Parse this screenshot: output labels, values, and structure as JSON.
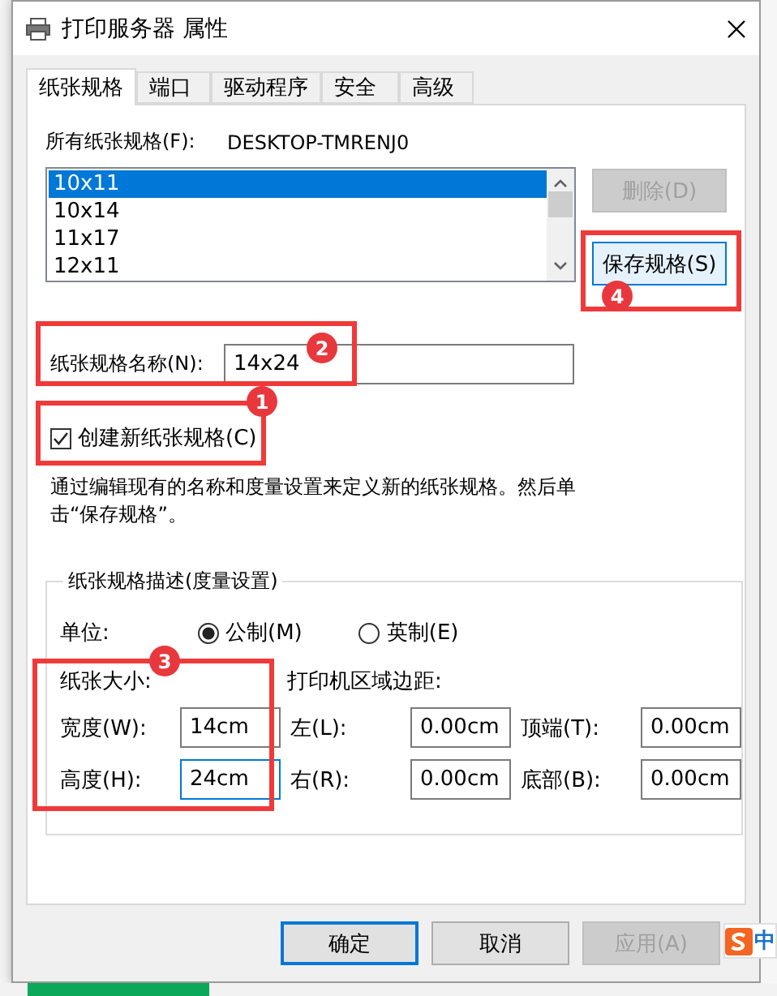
{
  "window": {
    "title": "打印服务器 属性"
  },
  "tabs": [
    {
      "label": "纸张规格",
      "selected": true
    },
    {
      "label": "端口",
      "selected": false
    },
    {
      "label": "驱动程序",
      "selected": false
    },
    {
      "label": "安全",
      "selected": false
    },
    {
      "label": "高级",
      "selected": false
    }
  ],
  "forms_list": {
    "label": "所有纸张规格(F):",
    "server": "DESKTOP-TMRENJ0",
    "items": [
      {
        "label": "10x11",
        "selected": true
      },
      {
        "label": "10x14",
        "selected": false
      },
      {
        "label": "11x17",
        "selected": false
      },
      {
        "label": "12x11",
        "selected": false
      }
    ]
  },
  "side_buttons": [
    {
      "label": "删除(D)",
      "disabled": true,
      "focused": false
    },
    {
      "label": "保存规格(S)",
      "disabled": false,
      "focused": true
    }
  ],
  "form_name": {
    "label": "纸张规格名称(N):",
    "value": "14x24"
  },
  "create_new": {
    "label": "创建新纸张规格(C)",
    "checked": true
  },
  "description": "通过编辑现有的名称和度量设置来定义新的纸张规格。然后单击“保存规格”。",
  "measurements": {
    "title": "纸张规格描述(度量设置)",
    "units_label": "单位:",
    "units": [
      {
        "label": "公制(M)",
        "selected": true
      },
      {
        "label": "英制(E)",
        "selected": false
      }
    ],
    "paper_size_label": "纸张大小:",
    "margins_label": "打印机区域边距:",
    "rows": [
      {
        "fields": [
          {
            "label": "宽度(W):",
            "value": "14cm",
            "focused": false
          },
          {
            "label": "左(L):",
            "value": "0.00cm",
            "focused": false
          },
          {
            "label": "顶端(T):",
            "value": "0.00cm",
            "focused": false
          }
        ]
      },
      {
        "fields": [
          {
            "label": "高度(H):",
            "value": "24cm",
            "focused": true
          },
          {
            "label": "右(R):",
            "value": "0.00cm",
            "focused": false
          },
          {
            "label": "底部(B):",
            "value": "0.00cm",
            "focused": false
          }
        ]
      }
    ]
  },
  "buttons": [
    {
      "label": "确定",
      "default": true,
      "disabled": false
    },
    {
      "label": "取消",
      "default": false,
      "disabled": false
    },
    {
      "label": "应用(A)",
      "default": false,
      "disabled": true
    }
  ],
  "annotations": [
    {
      "number": "1"
    },
    {
      "number": "2"
    },
    {
      "number": "3"
    },
    {
      "number": "4"
    }
  ],
  "ime": {
    "label": "中"
  }
}
